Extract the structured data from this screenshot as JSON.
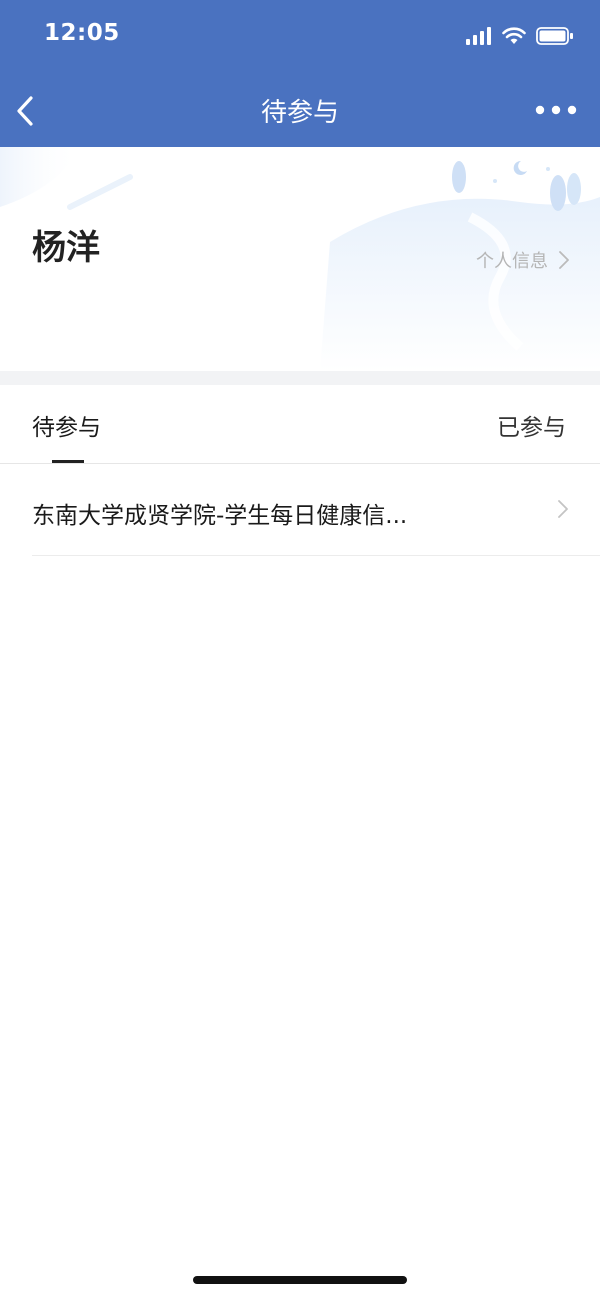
{
  "status_bar": {
    "time": "12:05",
    "icons": [
      "signal-icon",
      "wifi-icon",
      "battery-icon"
    ]
  },
  "nav": {
    "title": "待参与",
    "back_icon": "chevron-left-icon",
    "more_icon": "more-dots-icon"
  },
  "profile": {
    "name": "杨洋",
    "link_label": "个人信息"
  },
  "tabs": {
    "items": [
      {
        "label": "待参与",
        "active": true
      },
      {
        "label": "已参与",
        "active": false
      }
    ]
  },
  "list": {
    "items": [
      {
        "title": "东南大学成贤学院-学生每日健康信..."
      }
    ]
  },
  "colors": {
    "header": "#4a72c0",
    "divider": "#f2f3f5"
  }
}
